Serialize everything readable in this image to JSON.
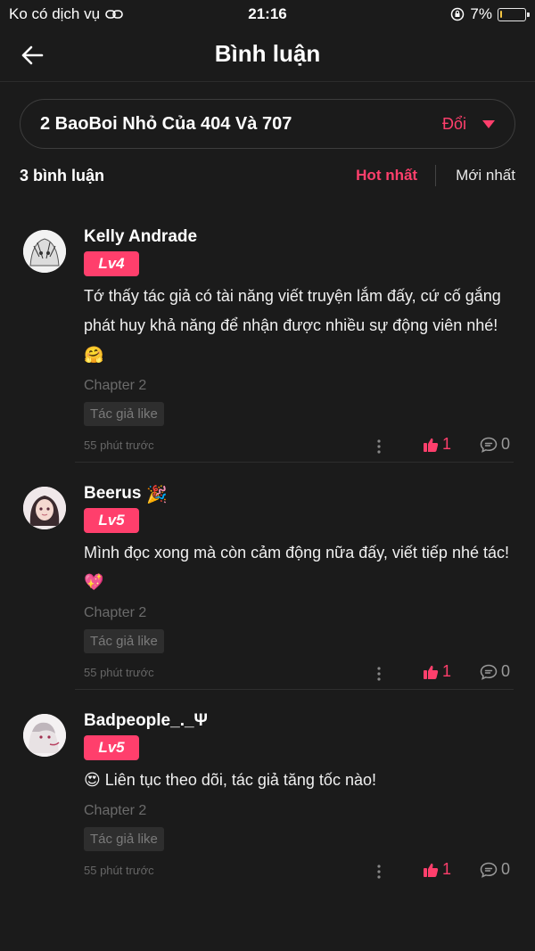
{
  "status": {
    "carrier": "Ko có dịch vụ",
    "time": "21:16",
    "battery": "7%",
    "battery_level": 0.07
  },
  "header": {
    "title": "Bình luận"
  },
  "chapter_selector": {
    "name": "2 BaoBoi Nhỏ Của 404 Và 707",
    "change_label": "Đổi"
  },
  "sort": {
    "count_label": "3 bình luận",
    "hot_label": "Hot nhất",
    "new_label": "Mới nhất"
  },
  "comments": [
    {
      "username": "Kelly Andrade",
      "emoji": "",
      "level": "Lv4",
      "text": "Tớ thấy tác giả có tài năng viết truyện lắm đấy, cứ cố gắng phát huy khả năng để nhận được nhiều sự động viên nhé! 🤗",
      "chapter": "Chapter 2",
      "tag": "Tác giả like",
      "time": "55 phút trước",
      "likes": "1",
      "replies": "0"
    },
    {
      "username": "Beerus",
      "emoji": "🎉",
      "level": "Lv5",
      "text": "Mình đọc xong mà còn cảm động nữa đấy, viết tiếp nhé tác! 💖",
      "chapter": "Chapter 2",
      "tag": "Tác giả like",
      "time": "55 phút trước",
      "likes": "1",
      "replies": "0"
    },
    {
      "username": "Badpeople_._Ψ",
      "emoji": "",
      "level": "Lv5",
      "text": "😍 Liên tục theo dõi, tác giả tăng tốc nào!",
      "chapter": "Chapter 2",
      "tag": "Tác giả like",
      "time": "55 phút trước",
      "likes": "1",
      "replies": "0"
    }
  ],
  "colors": {
    "accent": "#ff3f6c",
    "background": "#1b1b1b"
  }
}
